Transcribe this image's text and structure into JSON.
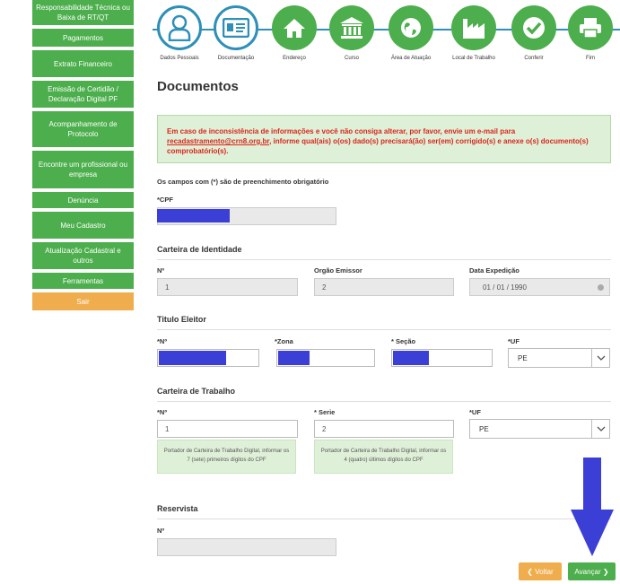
{
  "sidebar": {
    "items": [
      {
        "label": "Responsabilidade Técnica ou Baixa de RT/QT"
      },
      {
        "label": "Pagamentos"
      },
      {
        "label": "Extrato Financeiro"
      },
      {
        "label": "Emissão de Certidão / Declaração Digital PF"
      },
      {
        "label": "Acompanhamento de Protocolo"
      },
      {
        "label": "Encontre um profissional ou empresa"
      },
      {
        "label": "Denúncia"
      },
      {
        "label": "Meu Cadastro"
      },
      {
        "label": "Atualização Cadastral e outros"
      },
      {
        "label": "Ferramentas"
      },
      {
        "label": "Sair"
      }
    ]
  },
  "stepper": {
    "steps": [
      {
        "label": "Dados Pessoais",
        "icon": "person-icon"
      },
      {
        "label": "Documentação",
        "icon": "id-card-icon"
      },
      {
        "label": "Endereço",
        "icon": "home-icon"
      },
      {
        "label": "Curso",
        "icon": "university-icon"
      },
      {
        "label": "Área de Atuação",
        "icon": "globe-icon"
      },
      {
        "label": "Local de Trabalho",
        "icon": "factory-icon"
      },
      {
        "label": "Conferir",
        "icon": "check-icon"
      },
      {
        "label": "Fim",
        "icon": "printer-icon"
      }
    ]
  },
  "page": {
    "title": "Documentos",
    "alert_part1": "Em caso de inconsistência de informações e você não consiga alterar, por favor, envie um e-mail para",
    "alert_link": "recadastramento@crn8.org.br",
    "alert_part2": ", informe qual(ais) o(os) dado(s) precisará(ão) ser(em) corrigido(s) e anexe o(s) documento(s) comprobatório(s).",
    "required_note": "Os campos com (*) são de preenchimento obrigatório"
  },
  "cpf": {
    "label": "*CPF"
  },
  "identidade": {
    "heading": "Carteira de Identidade",
    "numero_label": "Nº",
    "numero_value": "1",
    "orgao_label": "Orgão Emissor",
    "orgao_value": "2",
    "data_label": "Data Expedição",
    "data_value": "01 / 01 / 1990"
  },
  "titulo": {
    "heading": "Titulo Eleitor",
    "numero_label": "*Nº",
    "zona_label": "*Zona",
    "secao_label": "* Seção",
    "uf_label": "*UF",
    "uf_value": "PE"
  },
  "trabalho": {
    "heading": "Carteira de Trabalho",
    "numero_label": "*Nº",
    "numero_value": "1",
    "serie_label": "* Serie",
    "serie_value": "2",
    "uf_label": "*UF",
    "uf_value": "PE",
    "hint_numero": "Portador de Carteira de Trabalho Digital, informar os 7 (sete) primeiros dígitos do CPF",
    "hint_serie": "Portador de Carteira de Trabalho Digital, informar os 4 (quatro) últimos dígitos do CPF"
  },
  "reservista": {
    "heading": "Reservista",
    "numero_label": "Nº"
  },
  "buttons": {
    "voltar": "❮ Voltar",
    "avancar": "Avançar ❯"
  },
  "colors": {
    "green": "#4cae4c",
    "orange": "#f0ad4e",
    "blue": "#2e8fb8",
    "redaction": "#3b3fd6",
    "alert_text": "#d9261c"
  }
}
